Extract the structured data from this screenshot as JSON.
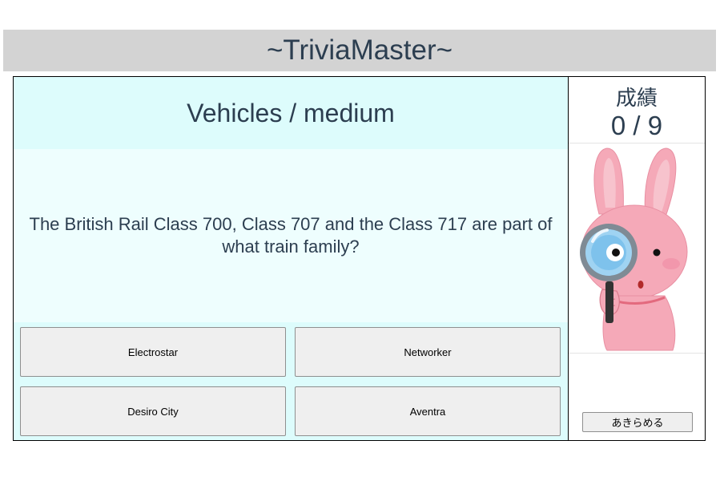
{
  "app": {
    "title": "~TriviaMaster~"
  },
  "quiz": {
    "category": "Vehicles",
    "separator": " / ",
    "difficulty": "medium",
    "question": "The British Rail Class 700, Class 707 and the Class 717 are part of what train family?",
    "answers": [
      {
        "label": "Electrostar"
      },
      {
        "label": "Networker"
      },
      {
        "label": "Desiro City"
      },
      {
        "label": "Aventra"
      }
    ]
  },
  "score": {
    "label": "成績",
    "value": "0 / 9"
  },
  "mascot": {
    "icon": "rabbit-with-magnifying-glass-icon"
  },
  "controls": {
    "give_up_label": "あきらめる"
  },
  "colors": {
    "header_bg": "#d3d3d3",
    "category_bg": "#ddfcfc",
    "question_bg": "#eefefe",
    "text": "#2c3e50",
    "button_bg": "#efefef"
  }
}
